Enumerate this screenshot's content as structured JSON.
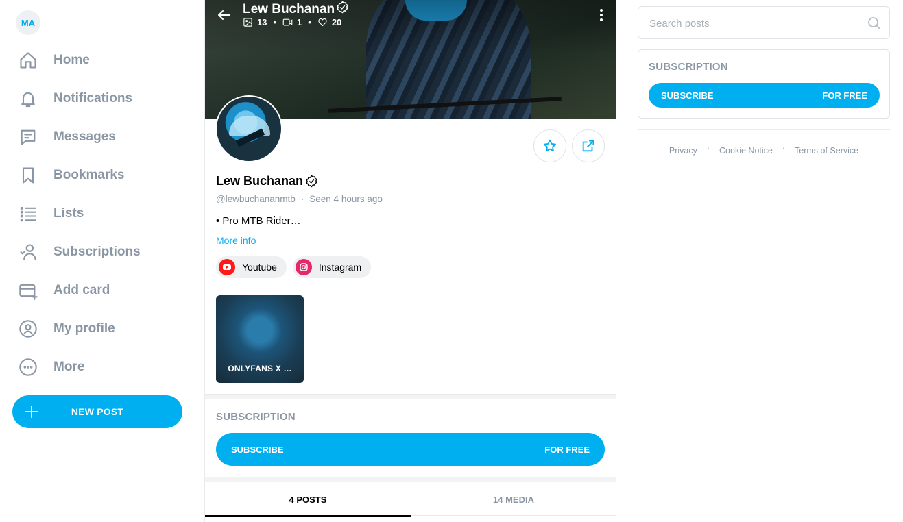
{
  "sidebar": {
    "avatar_initials": "MA",
    "items": [
      {
        "label": "Home",
        "icon": "home-icon"
      },
      {
        "label": "Notifications",
        "icon": "bell-icon"
      },
      {
        "label": "Messages",
        "icon": "message-icon"
      },
      {
        "label": "Bookmarks",
        "icon": "bookmark-icon"
      },
      {
        "label": "Lists",
        "icon": "list-icon"
      },
      {
        "label": "Subscriptions",
        "icon": "subscriptions-icon"
      },
      {
        "label": "Add card",
        "icon": "card-icon"
      },
      {
        "label": "My profile",
        "icon": "profile-icon"
      },
      {
        "label": "More",
        "icon": "more-icon"
      }
    ],
    "new_post_label": "NEW POST"
  },
  "profile": {
    "name": "Lew Buchanan",
    "stats": {
      "photos": "13",
      "videos": "1",
      "likes": "20"
    },
    "handle": "@lewbuchananmtb",
    "seen": "Seen 4 hours ago",
    "bio": "• Pro MTB Rider…",
    "more_info": "More info",
    "links": [
      {
        "label": "Youtube",
        "icon": "youtube-icon"
      },
      {
        "label": "Instagram",
        "icon": "instagram-icon"
      }
    ],
    "media_tile_caption": "ONLYFANS X …",
    "subscription_title": "SUBSCRIPTION",
    "subscribe_label": "SUBSCRIBE",
    "subscribe_price": "FOR FREE",
    "tabs": [
      {
        "label": "4 POSTS",
        "active": true
      },
      {
        "label": "14 MEDIA",
        "active": false
      }
    ]
  },
  "right": {
    "search_placeholder": "Search posts",
    "subscription_title": "SUBSCRIPTION",
    "subscribe_label": "SUBSCRIBE",
    "subscribe_price": "FOR FREE",
    "footer": [
      "Privacy",
      "Cookie Notice",
      "Terms of Service"
    ]
  },
  "colors": {
    "accent": "#00aff0",
    "muted": "#8a96a3"
  }
}
